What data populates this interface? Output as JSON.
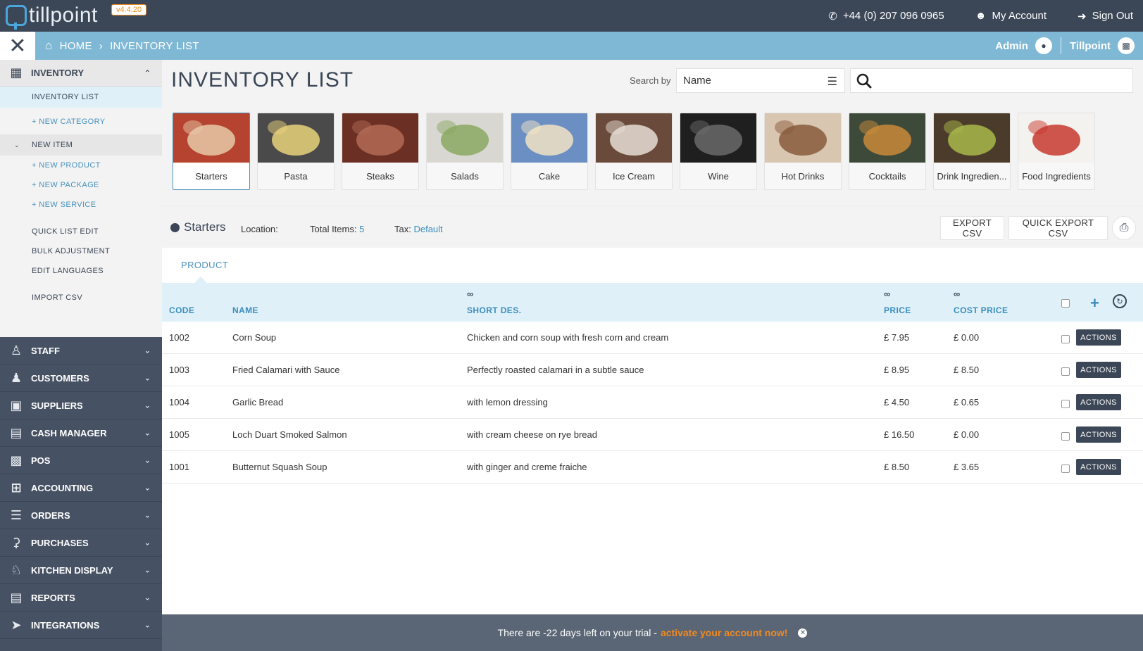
{
  "app": {
    "logo_text": "tillpoint",
    "version": "v4.4.20"
  },
  "topbar": {
    "phone": "+44 (0) 207 096 0965",
    "my_account": "My Account",
    "sign_out": "Sign Out"
  },
  "breadcrumb": {
    "home": "HOME",
    "current": "INVENTORY LIST",
    "user": "Admin",
    "company": "Tillpoint"
  },
  "sidebar": {
    "inventory_label": "INVENTORY",
    "sub_items": {
      "inventory_list": "INVENTORY LIST",
      "new_category": "+ NEW CATEGORY",
      "new_item": "NEW ITEM",
      "new_product": "+ NEW PRODUCT",
      "new_package": "+ NEW PACKAGE",
      "new_service": "+ NEW SERVICE",
      "quick_list_edit": "QUICK LIST EDIT",
      "bulk_adjustment": "BULK ADJUSTMENT",
      "edit_languages": "EDIT LANGUAGES",
      "import_csv": "IMPORT CSV"
    },
    "sections": [
      {
        "label": "STAFF",
        "icon": "staff-icon"
      },
      {
        "label": "CUSTOMERS",
        "icon": "customers-icon"
      },
      {
        "label": "SUPPLIERS",
        "icon": "truck-icon"
      },
      {
        "label": "CASH MANAGER",
        "icon": "register-icon"
      },
      {
        "label": "POS",
        "icon": "pos-icon"
      },
      {
        "label": "ACCOUNTING",
        "icon": "calculator-icon"
      },
      {
        "label": "ORDERS",
        "icon": "orders-icon"
      },
      {
        "label": "PURCHASES",
        "icon": "basket-icon"
      },
      {
        "label": "KITCHEN DISPLAY",
        "icon": "chef-icon"
      },
      {
        "label": "REPORTS",
        "icon": "chart-icon"
      },
      {
        "label": "INTEGRATIONS",
        "icon": "integrations-icon"
      }
    ]
  },
  "page": {
    "title": "INVENTORY LIST",
    "search_by_label": "Search by",
    "search_by_value": "Name",
    "search_placeholder": ""
  },
  "categories": [
    {
      "label": "Starters",
      "color1": "#b5432f",
      "color2": "#e7c9a8"
    },
    {
      "label": "Pasta",
      "color1": "#4a4a4a",
      "color2": "#e8d27a"
    },
    {
      "label": "Steaks",
      "color1": "#6b2f23",
      "color2": "#b26a55"
    },
    {
      "label": "Salads",
      "color1": "#d9d7d2",
      "color2": "#8aa862"
    },
    {
      "label": "Cake",
      "color1": "#6b8fc2",
      "color2": "#f2e3c5"
    },
    {
      "label": "Ice Cream",
      "color1": "#6a4a3a",
      "color2": "#e6ddd5"
    },
    {
      "label": "Wine",
      "color1": "#1f1f1f",
      "color2": "#6a6a6a"
    },
    {
      "label": "Hot Drinks",
      "color1": "#d8c6b1",
      "color2": "#8a5a3c"
    },
    {
      "label": "Cocktails",
      "color1": "#3d4a3a",
      "color2": "#c9893a"
    },
    {
      "label": "Drink Ingredien...",
      "color1": "#4b3b2a",
      "color2": "#a8b84a"
    },
    {
      "label": "Food Ingredients",
      "color1": "#f4f2ee",
      "color2": "#c73a2f"
    }
  ],
  "toolbar": {
    "category_name": "Starters",
    "location_label": "Location:",
    "total_items_label": "Total Items:",
    "total_items_value": "5",
    "tax_label": "Tax:",
    "tax_value": "Default",
    "export_csv": "EXPORT CSV",
    "quick_export_csv": "QUICK EXPORT CSV"
  },
  "tabs": {
    "product": "PRODUCT"
  },
  "table": {
    "columns": {
      "code": "CODE",
      "name": "NAME",
      "short_des": "SHORT DES.",
      "price": "PRICE",
      "cost_price": "COST PRICE"
    },
    "actions_label": "ACTIONS",
    "rows": [
      {
        "code": "1002",
        "name": "Corn Soup",
        "short_des": "Chicken and corn soup with fresh corn and cream",
        "price": "£ 7.95",
        "cost_price": "£ 0.00"
      },
      {
        "code": "1003",
        "name": "Fried Calamari with Sauce",
        "short_des": "Perfectly roasted calamari in a subtle sauce",
        "price": "£ 8.95",
        "cost_price": "£ 8.50"
      },
      {
        "code": "1004",
        "name": "Garlic Bread",
        "short_des": "with lemon dressing",
        "price": "£ 4.50",
        "cost_price": "£ 0.65"
      },
      {
        "code": "1005",
        "name": "Loch Duart Smoked Salmon",
        "short_des": "with cream cheese on rye bread",
        "price": "£ 16.50",
        "cost_price": "£ 0.00"
      },
      {
        "code": "1001",
        "name": "Butternut Squash Soup",
        "short_des": "with ginger and creme fraiche",
        "price": "£ 8.50",
        "cost_price": "£ 3.65"
      }
    ]
  },
  "trial": {
    "message": "There are -22 days left on your trial -",
    "link": "activate your account now!"
  }
}
